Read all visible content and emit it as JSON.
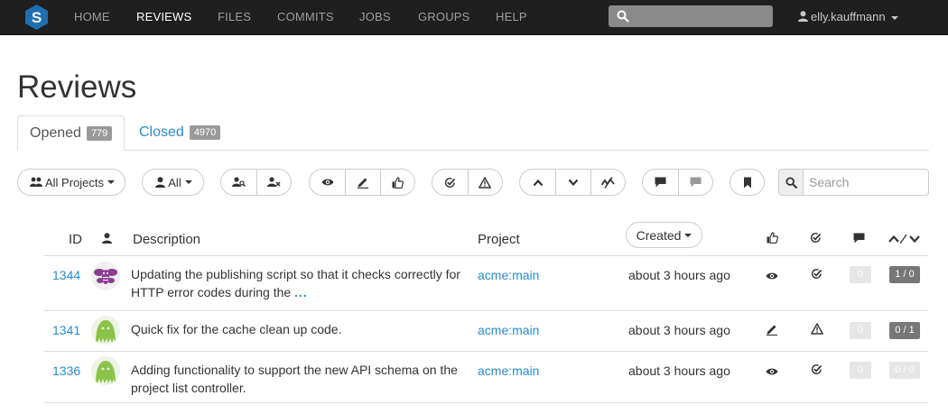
{
  "nav": {
    "items": [
      "HOME",
      "REVIEWS",
      "FILES",
      "COMMITS",
      "JOBS",
      "GROUPS",
      "HELP"
    ],
    "active": "REVIEWS",
    "user": "elly.kauffmann",
    "search_placeholder": ""
  },
  "page": {
    "title": "Reviews"
  },
  "tabs": [
    {
      "label": "Opened",
      "count": "779"
    },
    {
      "label": "Closed",
      "count": "4970"
    }
  ],
  "filters": {
    "projects_label": "All Projects",
    "user_label": "All",
    "search_placeholder": "Search"
  },
  "table": {
    "headers": {
      "id": "ID",
      "description": "Description",
      "project": "Project",
      "created": "Created"
    },
    "rows": [
      {
        "id": "1344",
        "description": "Updating the publishing script so that it checks correctly for HTTP error codes during the",
        "truncated": true,
        "ellipsis": "...",
        "project": "acme:main",
        "created": "about 3 hours ago",
        "state_icon": "eye-icon",
        "test_icon": "check-icon",
        "comments": "0",
        "votes": "1 / 0",
        "votes_dim": false
      },
      {
        "id": "1341",
        "description": "Quick fix for the cache clean up code.",
        "truncated": false,
        "project": "acme:main",
        "created": "about 3 hours ago",
        "state_icon": "pencil-icon",
        "test_icon": "warning-icon",
        "comments": "0",
        "votes": "0 / 1",
        "votes_dim": false
      },
      {
        "id": "1336",
        "description": "Adding functionality to support the new API schema on the project list controller.",
        "truncated": false,
        "project": "acme:main",
        "created": "about 3 hours ago",
        "state_icon": "eye-icon",
        "test_icon": "check-icon",
        "comments": "0",
        "votes": "0 / 0",
        "votes_dim": true
      }
    ]
  },
  "colors": {
    "link": "#2a8ccc",
    "navbar": "#1f1f1f",
    "badge": "#999999",
    "logo": "#1e6fb0"
  }
}
